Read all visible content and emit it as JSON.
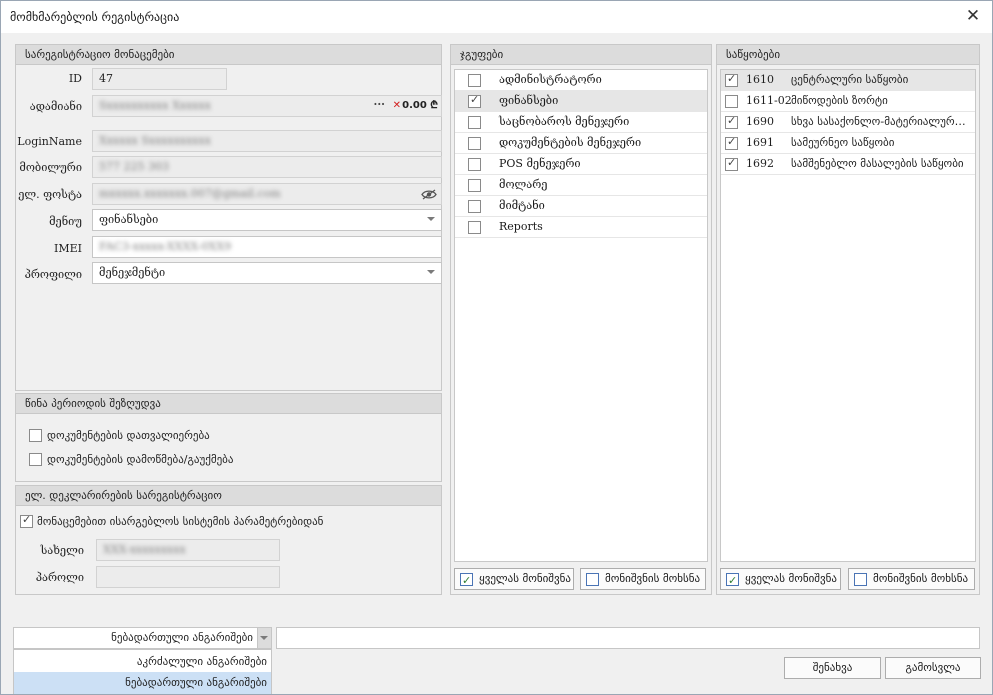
{
  "window": {
    "title": "მომხმარებლის რეგისტრაცია",
    "close_glyph": "✕"
  },
  "registration": {
    "header": "სარეგისტრაციო მონაცემები",
    "id_label": "ID",
    "id_value": "47",
    "person_label": "ადამიანი",
    "person_value": "Sxxxxxxxxxx Xxxxxx",
    "person_more": "···",
    "person_clear": "✕",
    "person_amount": "0.00 ₾",
    "login_label": "LoginName",
    "login_value": "Xxxxxx Sxxxxxxxxxx",
    "mobile_label": "მობილური",
    "mobile_value": "577 225 303",
    "email_label": "ელ. ფოსტა",
    "email_value": "mxxxxx.xxxxxxx.007@gmail.com",
    "menu_label": "მენიუ",
    "menu_value": "ფინანსები",
    "imei_label": "IMEI",
    "imei_value": "FAC3-xxxxx-XXXX-0XX9",
    "profile_label": "პროფილი",
    "profile_value": "მენეჯმენტი"
  },
  "prev_period": {
    "header": "წინა პერიოდის შეზღუდვა",
    "opt1": "დოკუმენტების დათვალიერება",
    "opt2": "დოკუმენტების დამოწმება/გაუქმება"
  },
  "edecl": {
    "header": "ელ. დეკლარირების სარეგისტრაციო",
    "use_params": "მონაცემებით ისარგებლოს სისტემის პარამეტრებიდან",
    "name_label": "სახელი",
    "name_value": "XXX-xxxxxxxxx",
    "password_label": "პაროლი",
    "password_value": ""
  },
  "groups": {
    "header": "ჯგუფები",
    "items": [
      {
        "label": "ადმინისტრატორი",
        "checked": false
      },
      {
        "label": "ფინანსები",
        "checked": true
      },
      {
        "label": "საცნობაროს მენეჯერი",
        "checked": false
      },
      {
        "label": "დოკუმენტების მენეჯერი",
        "checked": false
      },
      {
        "label": "POS მენეჯერი",
        "checked": false
      },
      {
        "label": "მოლარე",
        "checked": false
      },
      {
        "label": "მიმტანი",
        "checked": false
      },
      {
        "label": "Reports",
        "checked": false
      }
    ],
    "select_all": "ყველას მონიშვნა",
    "deselect": "მონიშვნის მოხსნა"
  },
  "warehouses": {
    "header": "საწყობები",
    "items": [
      {
        "code": "1610",
        "name": "ცენტრალური საწყობი",
        "checked": true
      },
      {
        "code": "1611-02",
        "name": "მიწოდების ზორტი",
        "checked": false
      },
      {
        "code": "1690",
        "name": "სხვა სასაქონლო-მატერიალური მ...",
        "checked": true
      },
      {
        "code": "1691",
        "name": "სამეურნეო საწყობი",
        "checked": true
      },
      {
        "code": "1692",
        "name": "სამშენებლო მასალების საწყობი",
        "checked": true
      }
    ],
    "select_all": "ყველას მონიშვნა",
    "deselect": "მონიშვნის მოხსნა"
  },
  "bottom": {
    "accounts_value": "ნებადართული ანგარიშები",
    "accounts_options": [
      "აკრძალული ანგარიშები",
      "ნებადართული ანგარიშები"
    ],
    "filter_value": "",
    "save": "შენახვა",
    "exit": "გამოსვლა"
  }
}
